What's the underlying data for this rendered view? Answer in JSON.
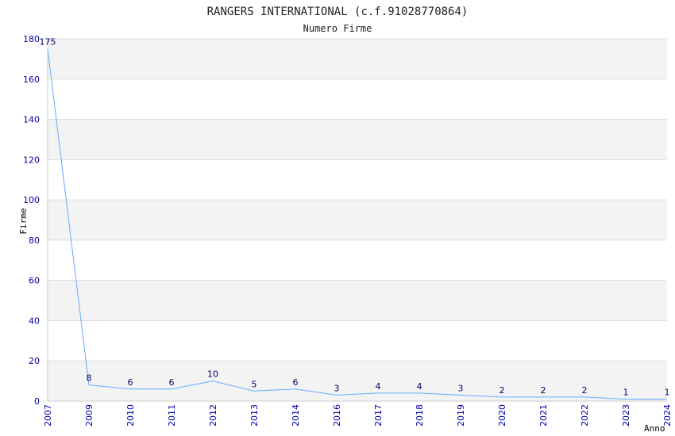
{
  "chart_data": {
    "type": "line",
    "title": "RANGERS INTERNATIONAL (c.f.91028770864)",
    "subtitle": "Numero Firme",
    "xlabel": "Anno",
    "ylabel": "Firme",
    "x": [
      "2007",
      "2009",
      "2010",
      "2011",
      "2012",
      "2013",
      "2014",
      "2016",
      "2017",
      "2018",
      "2019",
      "2020",
      "2021",
      "2022",
      "2023",
      "2024"
    ],
    "y": [
      175,
      8,
      6,
      6,
      10,
      5,
      6,
      3,
      4,
      4,
      3,
      2,
      2,
      2,
      1,
      1
    ],
    "ylim": [
      0,
      180
    ],
    "yticks": [
      0,
      20,
      40,
      60,
      80,
      100,
      120,
      140,
      160,
      180
    ],
    "grid": "horizontal bands, alternating white and light gray",
    "line_color": "#66aaff",
    "tick_color": "#0000aa",
    "band_color": "#f3f3f3"
  }
}
